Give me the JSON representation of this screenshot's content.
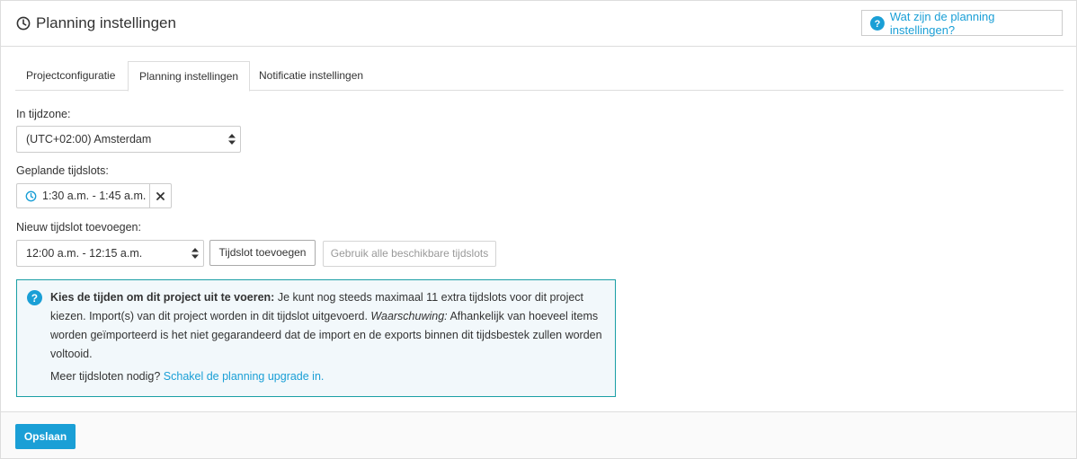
{
  "header": {
    "title": "Planning instellingen",
    "help_label": "Wat zijn de planning instellingen?"
  },
  "tabs": [
    {
      "label": "Projectconfiguratie"
    },
    {
      "label": "Planning instellingen",
      "active": true
    },
    {
      "label": "Notificatie instellingen"
    }
  ],
  "timezone": {
    "label": "In tijdzone:",
    "value": "(UTC+02:00) Amsterdam"
  },
  "scheduled": {
    "label": "Geplande tijdslots:",
    "slots": [
      {
        "text": "1:30 a.m. - 1:45 a.m."
      }
    ]
  },
  "new_slot": {
    "label": "Nieuw tijdslot toevoegen:",
    "value": "12:00 a.m. - 12:15 a.m.",
    "add_label": "Tijdslot toevoegen",
    "use_all_label": "Gebruik alle beschikbare tijdslots"
  },
  "info": {
    "bold": "Kies de tijden om dit project uit te voeren:",
    "text1": " Je kunt nog steeds maximaal 11 extra tijdslots voor dit project kiezen. Import(s) van dit project worden in dit tijdslot uitgevoerd. ",
    "italic": "Waarschuwing:",
    "text2": " Afhankelijk van hoeveel items worden geïmporteerd is het niet gegarandeerd dat de import en de exports binnen dit tijdsbestek zullen worden voltooid.",
    "more_text": "Meer tijdsloten nodig? ",
    "more_link": "Schakel de planning upgrade in."
  },
  "footer": {
    "save_label": "Opslaan"
  },
  "colors": {
    "accent": "#1a9fd6",
    "info_border": "#1a9fa5",
    "info_bg": "#f2f8fb"
  },
  "icons": {
    "title": "clock-icon",
    "help": "question-circle-icon",
    "slot": "clock-icon",
    "remove": "close-icon",
    "select": "sort-arrows-icon",
    "info": "question-circle-icon"
  }
}
